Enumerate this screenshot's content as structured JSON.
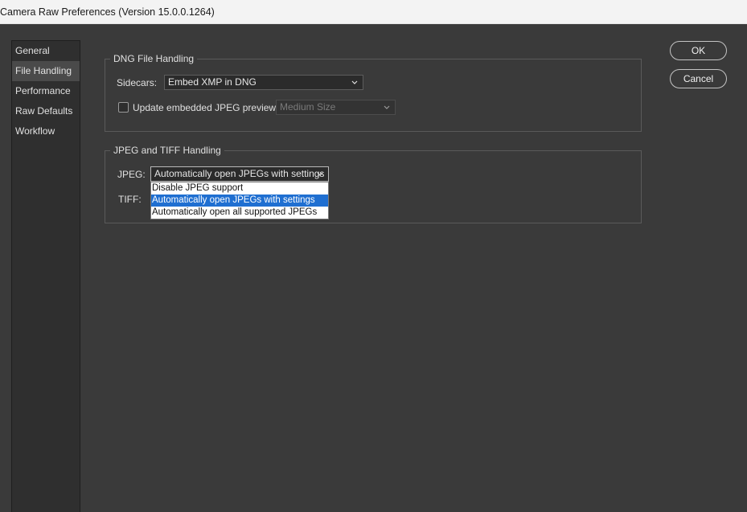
{
  "window": {
    "title": "Camera Raw Preferences  (Version 15.0.0.1264)"
  },
  "sidebar": {
    "items": [
      {
        "label": "General"
      },
      {
        "label": "File Handling"
      },
      {
        "label": "Performance"
      },
      {
        "label": "Raw Defaults"
      },
      {
        "label": "Workflow"
      }
    ],
    "active_index": 1
  },
  "dng": {
    "group_label": "DNG File Handling",
    "sidecars_label": "Sidecars:",
    "sidecars_value": "Embed XMP in DNG",
    "update_previews_label": "Update embedded JPEG previews:",
    "update_previews_checked": false,
    "preview_size_value": "Medium Size"
  },
  "jpeg_tiff": {
    "group_label": "JPEG and TIFF Handling",
    "jpeg_label": "JPEG:",
    "jpeg_value": "Automatically open JPEGs with settings",
    "tiff_label": "TIFF:",
    "jpeg_options": [
      "Disable JPEG support",
      "Automatically open JPEGs with settings",
      "Automatically open all supported JPEGs"
    ],
    "jpeg_selected_index": 1
  },
  "buttons": {
    "ok": "OK",
    "cancel": "Cancel"
  },
  "colors": {
    "dialog_bg": "#3a3a3a",
    "sidebar_bg": "#2f2f2f",
    "selection": "#1f6fd1"
  }
}
